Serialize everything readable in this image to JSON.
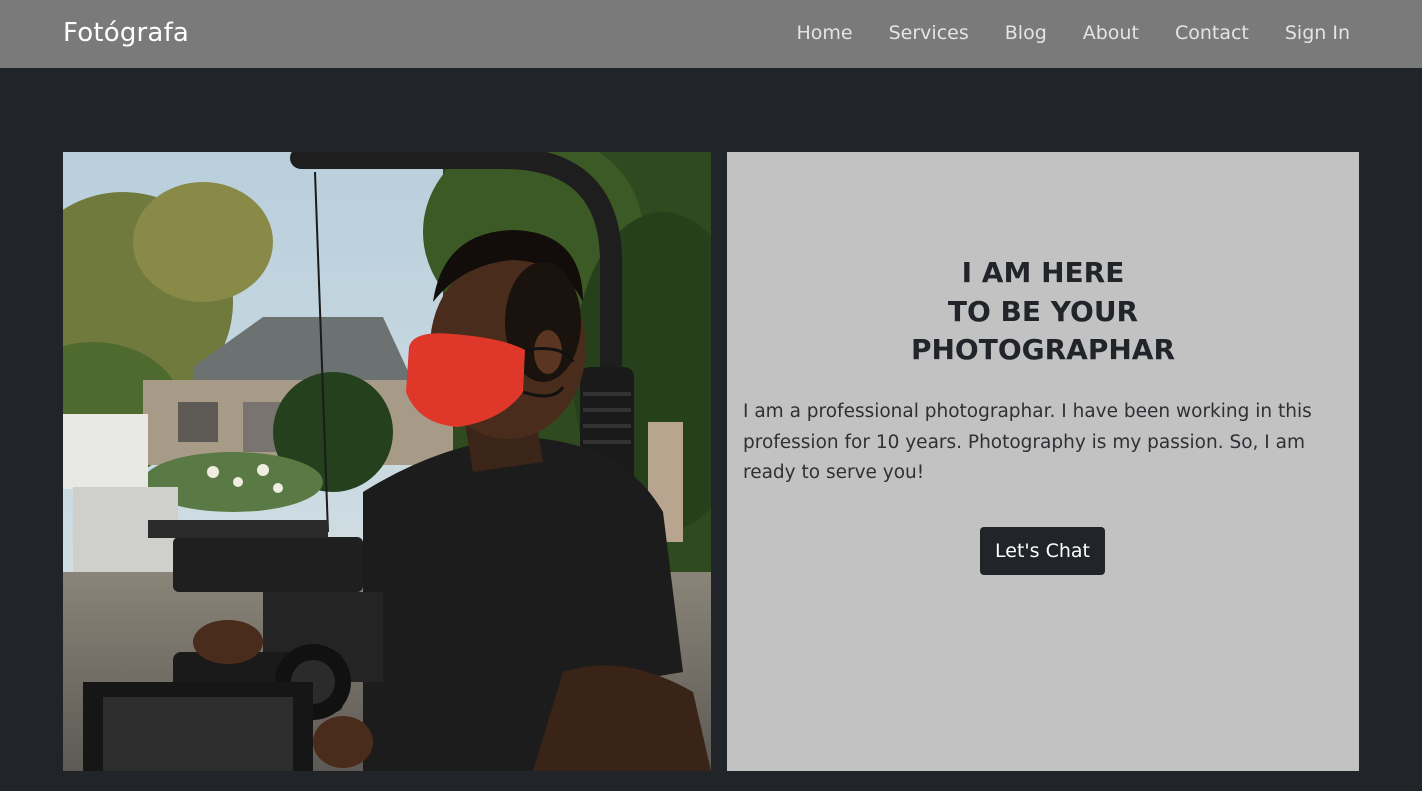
{
  "navbar": {
    "brand": "Fotógrafa",
    "links": [
      {
        "label": "Home"
      },
      {
        "label": "Services"
      },
      {
        "label": "Blog"
      },
      {
        "label": "About"
      },
      {
        "label": "Contact"
      },
      {
        "label": "Sign In"
      }
    ]
  },
  "hero": {
    "title_lines": [
      "I AM HERE",
      "TO BE YOUR",
      "PHOTOGRAPHAR"
    ],
    "text": "I am a professional photographar. I have been working in this profession for 10 years. Photography is my passion. So, I am ready to serve you!",
    "button_label": "Let's Chat"
  },
  "colors": {
    "navbar_bg": "#7a7a7a",
    "page_bg": "#212429",
    "card_bg": "#c2c2c2",
    "button_bg": "#212429",
    "mask": "#e0372b"
  }
}
